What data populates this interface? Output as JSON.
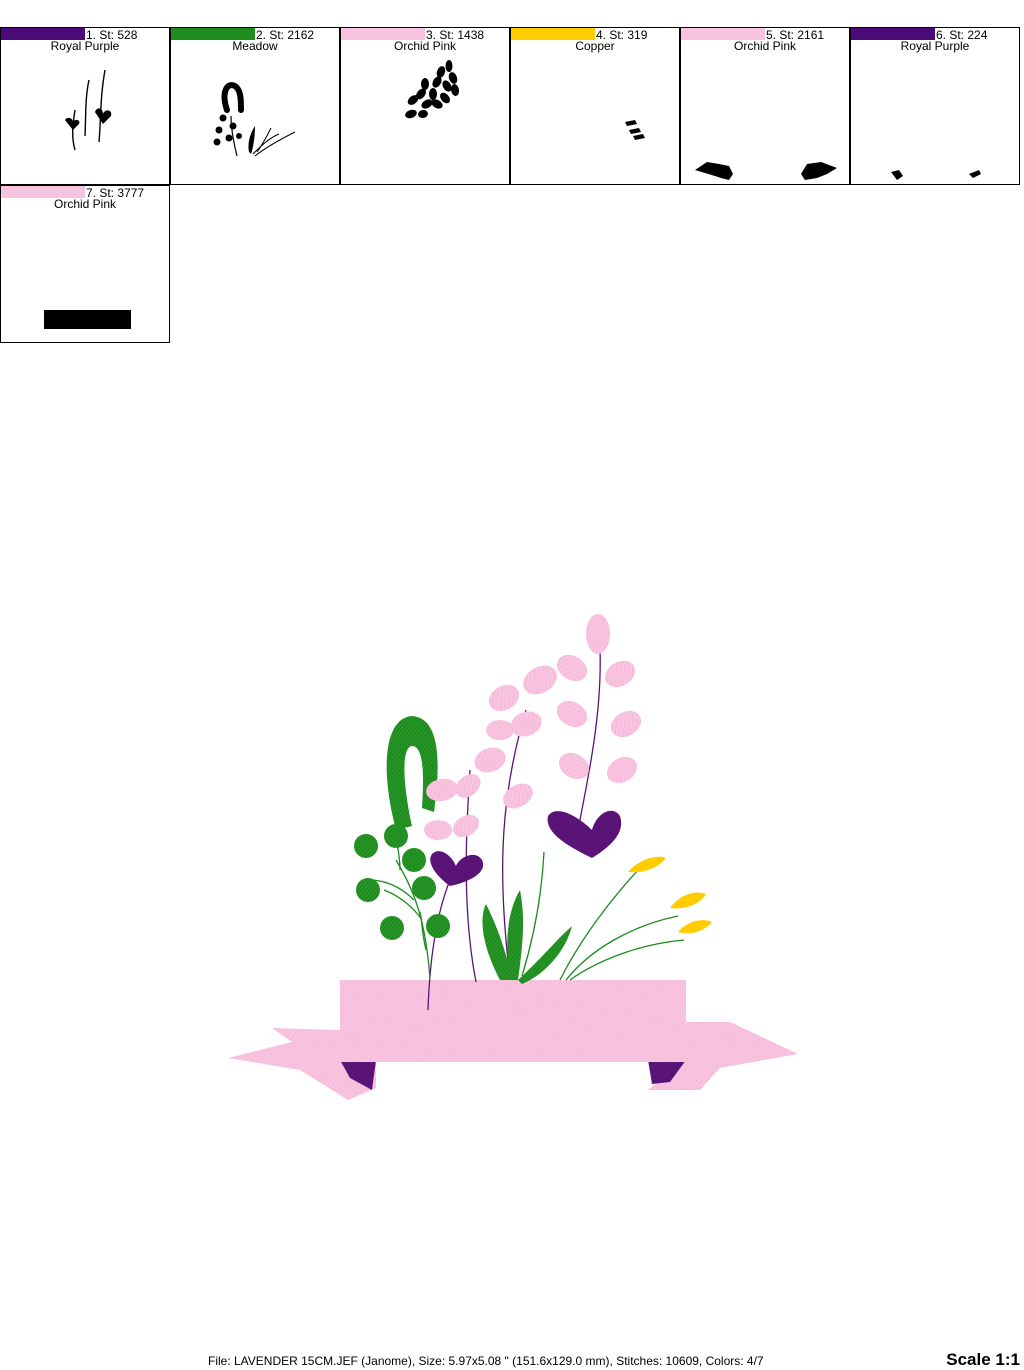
{
  "colors": [
    {
      "step_label": "1. St: 528",
      "name": "Royal Purple",
      "hex": "#4b0a78"
    },
    {
      "step_label": "2. St: 2162",
      "name": "Meadow",
      "hex": "#1e8c1e"
    },
    {
      "step_label": "3. St: 1438",
      "name": "Orchid Pink",
      "hex": "#f8c3df"
    },
    {
      "step_label": "4. St: 319",
      "name": "Copper",
      "hex": "#ffcc00"
    },
    {
      "step_label": "5. St: 2161",
      "name": "Orchid Pink",
      "hex": "#f8c3df"
    },
    {
      "step_label": "6. St: 224",
      "name": "Royal Purple",
      "hex": "#4b0a78"
    },
    {
      "step_label": "7. St: 3777",
      "name": "Orchid Pink",
      "hex": "#f8c3df"
    }
  ],
  "footer": {
    "info": "File: LAVENDER 15CM.JEF (Janome), Size: 5.97x5.08 \" (151.6x129.0 mm), Stitches: 10609, Colors: 4/7",
    "scale": "Scale 1:1"
  },
  "palette": {
    "pink": "#f8c3df",
    "green": "#1e8c1e",
    "purple": "#5a1478",
    "yellow": "#ffcc00"
  }
}
